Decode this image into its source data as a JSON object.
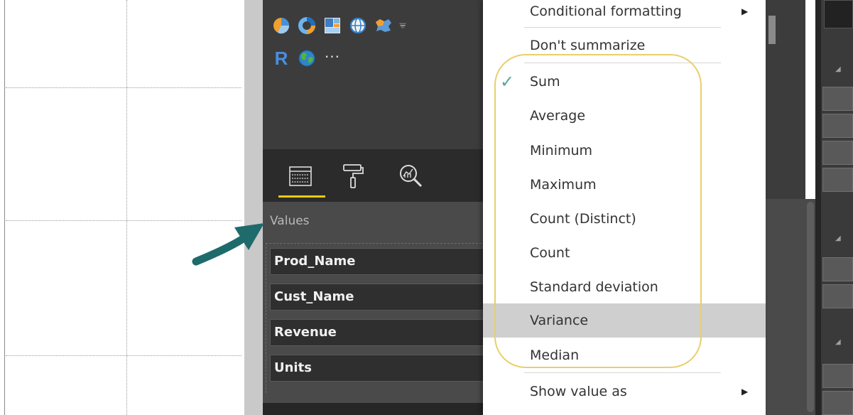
{
  "visualizations": {
    "icons": [
      "pie-chart-icon",
      "donut-chart-icon",
      "treemap-icon",
      "globe-map-icon",
      "filled-map-icon",
      "funnel-icon",
      "r-visual-icon",
      "arcgis-globe-icon",
      "more-visuals-icon"
    ],
    "r_label": "R",
    "more_label": "···"
  },
  "panel_tabs": {
    "items": [
      "fields-tab",
      "format-tab",
      "analytics-tab"
    ],
    "active": "fields-tab",
    "active_color": "#f2c811"
  },
  "values_section": {
    "label": "Values",
    "fields": [
      "Prod_Name",
      "Cust_Name",
      "Revenue",
      "Units"
    ]
  },
  "context_menu": {
    "items": [
      {
        "label": "Conditional formatting",
        "submenu": true
      },
      {
        "label": "Don't summarize"
      },
      {
        "label": "Sum",
        "checked": true
      },
      {
        "label": "Average"
      },
      {
        "label": "Minimum"
      },
      {
        "label": "Maximum"
      },
      {
        "label": "Count (Distinct)"
      },
      {
        "label": "Count"
      },
      {
        "label": "Standard deviation"
      },
      {
        "label": "Variance",
        "highlighted": true
      },
      {
        "label": "Median"
      },
      {
        "label": "Show value as",
        "submenu": true
      }
    ],
    "check_glyph": "✓",
    "submenu_glyph": "▶",
    "check_color": "#5aa69b",
    "highlight_color": "#cfcfcf",
    "annotation_color": "#e8cf6a"
  },
  "well_controls": {
    "remove_glyph": "×",
    "expand_glyph": "▾"
  },
  "annotation": {
    "arrow_color": "#1f6b6b"
  }
}
